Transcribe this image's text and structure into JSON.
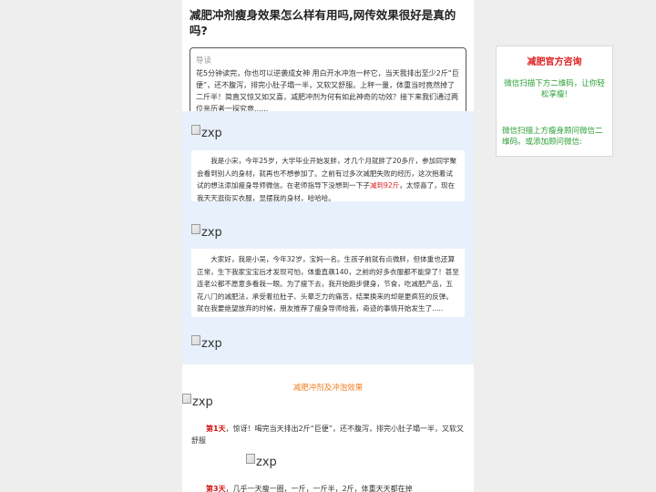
{
  "article": {
    "title": "减肥冲剂瘦身效果怎么样有用吗,网传效果很好是真的吗?",
    "guide_label": "导读",
    "guide_text": "花5分钟读完，你也可以逆袭成女神 用白开水冲泡一杯它，当天我排出至少2斤“巨便”，还不腹泻，排完小肚子塌一半，又软又舒服。上秤一量，体重当时竟然掉了二斤半！简直又惊又如又喜，减肥冲剂为何有如此神奇的功效？接下来我们通过两位亲历者一探究竟......",
    "img_alt": "zxp",
    "story1_before": "我是小宋，今年25岁，大学毕业开始发胖，才几个月就胖了20多斤，参加同学聚会看到别人的身材，就再也不想参加了。之前有过多次减肥失败的经历，这次抱着试试的想法添加瘦身导师微信。在老师指导下没想到一下子",
    "story1_red": "减到92斤",
    "story1_after": "，太惊喜了，现在我天天逛街买衣服，显摆我的身材，哈哈哈。",
    "story2": "大家好，我是小吴，今年32岁，宝妈一名。生孩子前就有点微胖，但体重也还算正常，生下我家宝宝后才发现可怕，体重直飙140，之前的好多衣服都不能穿了！甚至连老公都不愿意多看我一眼。为了瘦下去，我开始跑步健身，节食，吃减肥产品，五花八门的减肥法，承受着拉肚子、头晕乏力的痛苦，结果换来的却是更疯狂的反弹。就在我要绝望放弃的时候，朋友推荐了瘦身导师给我，奇迹的事情开始发生了.....",
    "section_heading": "减肥冲剂及冲泡效果",
    "day1_label": "第1天",
    "day1_text": "，惊讶！喝完当天排出2斤“巨便”，还不腹泻，排完小肚子塌一半，又软又舒服",
    "day3_label": "第3天",
    "day3_text": "，几乎一天瘦一圈，一斤，一斤半，2斤，体重天天都在掉"
  },
  "side": {
    "title": "减肥官方咨询",
    "text1": "微信扫描下方二维码，让你轻松享瘦!",
    "text2": "微信扫描上方瘦身顾问微信二维码。或添加顾问微信:"
  }
}
